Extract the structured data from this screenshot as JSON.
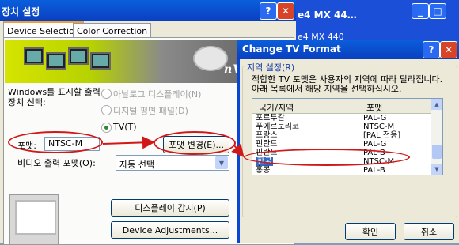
{
  "background_window": {
    "title": "e4 MX 44…",
    "subtitle": "e4 MX 440"
  },
  "main_window": {
    "title": "장치 설정",
    "tabs": [
      "Device Selection",
      "Color Correction"
    ],
    "banner_logo": "nVIDIA.",
    "output_label": "Windows를 표시할 출력 장치 선택:",
    "radios": [
      {
        "label": "아날로그 디스플레이(N)",
        "enabled": false,
        "checked": false
      },
      {
        "label": "디지털 평면 패널(D)",
        "enabled": false,
        "checked": false
      },
      {
        "label": "TV(T)",
        "enabled": true,
        "checked": true
      }
    ],
    "format_label": "포맷:",
    "format_value": "NTSC-M",
    "change_format_button": "포맷 변경(E)...",
    "video_output_label": "비디오 출력 포맷(O):",
    "video_output_value": "자동 선택",
    "detect_button": "디스플레이 감지(P)",
    "adjust_button": "Device Adjustments..."
  },
  "dialog": {
    "title": "Change TV Format",
    "group_label": "지역 설정(R)",
    "description": "적합한 TV 포맷은 사용자의 지역에 따라 달라집니다. 아래 목록에서 해당 지역을 선택하십시오.",
    "columns": [
      "국가/지역",
      "포맷"
    ],
    "rows": [
      {
        "country": "포르투갈",
        "format": "PAL-G"
      },
      {
        "country": "푸에르토리코",
        "format": "NTSC-M"
      },
      {
        "country": "프랑스",
        "format": "[PAL 전용]"
      },
      {
        "country": "핀란드",
        "format": "PAL-G"
      },
      {
        "country": "핀란드",
        "format": "PAL-B"
      },
      {
        "country": "한국",
        "format": "NTSC-M",
        "selected": true
      },
      {
        "country": "홍콩",
        "format": "PAL-B"
      }
    ],
    "ok_button": "확인",
    "cancel_button": "취소"
  },
  "colors": {
    "title_bar": "#0a4fd6",
    "annotation_red": "#d01818",
    "selection": "#316ac5"
  }
}
